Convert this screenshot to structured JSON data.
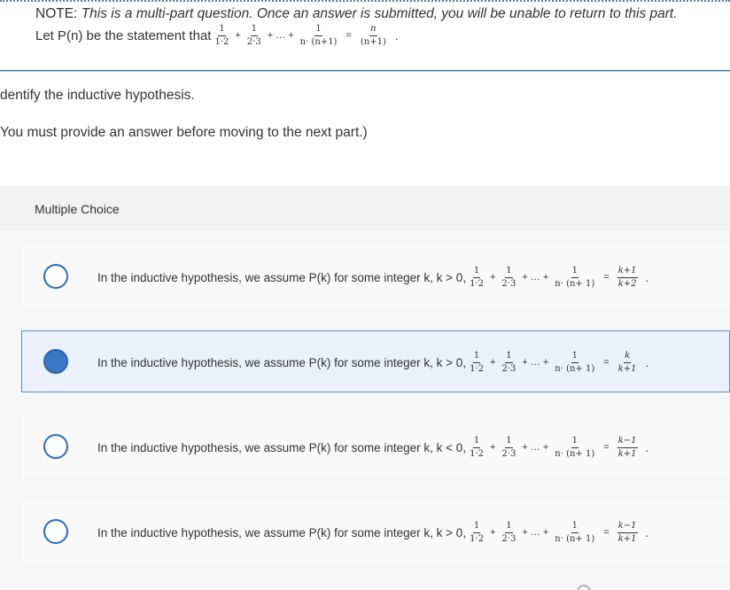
{
  "note": {
    "label": "NOTE:",
    "text": "This is a multi-part question. Once an answer is submitted, you will be unable to return to this part."
  },
  "statement": {
    "prefix": "Let P(n) be the statement that",
    "t1": {
      "num": "1",
      "den": "1·2"
    },
    "t2": {
      "num": "1",
      "den": "2·3"
    },
    "ellipsis": "+ … +",
    "plus": "+",
    "tn": {
      "num": "1",
      "den": "n· (n+1)"
    },
    "eq": "=",
    "rhs": {
      "num": "n",
      "den": "(n+1)"
    },
    "end": "."
  },
  "instruction": "dentify the inductive hypothesis.",
  "requirement": "You must provide an answer before moving to the next part.)",
  "multiple_choice_label": "Multiple Choice",
  "choices": [
    {
      "prefix": "In the inductive hypothesis, we assume P(k) for some integer k, k > 0,",
      "t1": {
        "num": "1",
        "den": "1·2"
      },
      "t2": {
        "num": "1",
        "den": "2·3"
      },
      "tn": {
        "num": "1",
        "den": "n· (n+ 1)"
      },
      "rhs": {
        "num": "k+1",
        "den": "k+2"
      },
      "selected": false
    },
    {
      "prefix": "In the inductive hypothesis, we assume P(k) for some integer k, k > 0,",
      "t1": {
        "num": "1",
        "den": "1·2"
      },
      "t2": {
        "num": "1",
        "den": "2·3"
      },
      "tn": {
        "num": "1",
        "den": "n· (n+ 1)"
      },
      "rhs": {
        "num": "k",
        "den": "k+1"
      },
      "selected": true
    },
    {
      "prefix": "In the inductive hypothesis, we assume P(k) for some integer k, k < 0,",
      "t1": {
        "num": "1",
        "den": "1·2"
      },
      "t2": {
        "num": "1",
        "den": "2·3"
      },
      "tn": {
        "num": "1",
        "den": "n· (n+ 1)"
      },
      "rhs": {
        "num": "k−1",
        "den": "k+1"
      },
      "selected": false
    },
    {
      "prefix": "In the inductive hypothesis, we assume P(k) for some integer k, k > 0,",
      "t1": {
        "num": "1",
        "den": "1·2"
      },
      "t2": {
        "num": "1",
        "den": "2·3"
      },
      "tn": {
        "num": "1",
        "den": "n· (n+ 1)"
      },
      "rhs": {
        "num": "k−1",
        "den": "k+1"
      },
      "selected": false
    }
  ],
  "colors": {
    "accent": "#2a6ebb",
    "selected_fill": "#3a78c4",
    "selected_bg": "#eaf1fa"
  }
}
